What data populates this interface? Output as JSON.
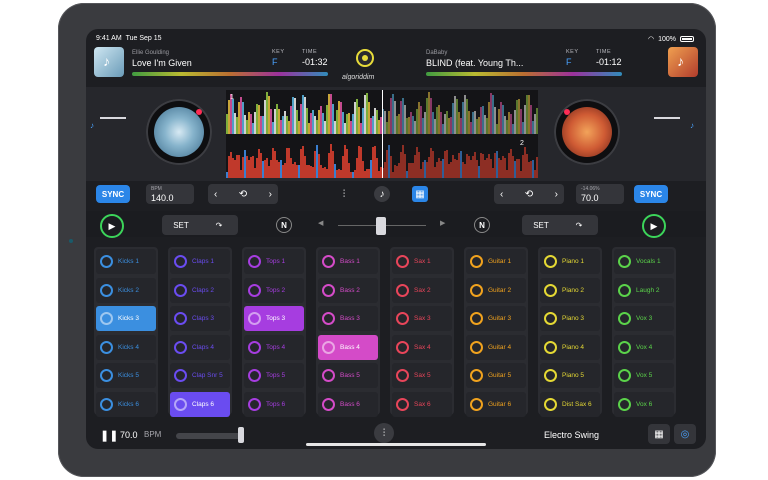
{
  "status": {
    "time": "9:41 AM",
    "date": "Tue Sep 15",
    "battery": "100%"
  },
  "deck_left": {
    "artist": "Ellie Goulding",
    "title": "Love I'm Given",
    "key_label": "KEY",
    "key": "F",
    "time_label": "TIME",
    "time": "-01:32",
    "bpm_label": "BPM",
    "bpm": "140.0",
    "sync_label": "SYNC",
    "set_label": "SET",
    "wave_number": "1",
    "progress": 0.72
  },
  "deck_right": {
    "artist": "DaBaby",
    "title": "BLIND (feat. Young Th...",
    "key_label": "KEY",
    "key": "F",
    "time_label": "TIME",
    "time": "-01:12",
    "pitch_label": "-14.06%",
    "bpm": "70.0",
    "sync_label": "SYNC",
    "set_label": "SET",
    "wave_number": "2",
    "progress": 0.55
  },
  "brand": "algoriddim",
  "pad_columns": [
    {
      "color": "#3b8fe0",
      "active": 2,
      "pads": [
        "Kicks 1",
        "Kicks 2",
        "Kicks 3",
        "Kicks 4",
        "Kicks 5",
        "Kicks 6"
      ]
    },
    {
      "color": "#6a4cf0",
      "active": 5,
      "pads": [
        "Claps 1",
        "Claps 2",
        "Claps 3",
        "Claps 4",
        "Clap Snr 5",
        "Claps 6"
      ]
    },
    {
      "color": "#a63de0",
      "active": 2,
      "pads": [
        "Tops 1",
        "Tops 2",
        "Tops 3",
        "Tops 4",
        "Tops 5",
        "Tops 6"
      ]
    },
    {
      "color": "#d44bc8",
      "active": 3,
      "pads": [
        "Bass 1",
        "Bass 2",
        "Bass 3",
        "Bass 4",
        "Bass 5",
        "Bass 6"
      ]
    },
    {
      "color": "#e8455a",
      "active": -1,
      "pads": [
        "Sax 1",
        "Sax 2",
        "Sax 3",
        "Sax 4",
        "Sax 5",
        "Sax 6"
      ]
    },
    {
      "color": "#f0a21e",
      "active": -1,
      "pads": [
        "Guitar 1",
        "Guitar 2",
        "Guitar 3",
        "Guitar 4",
        "Guitar 5",
        "Guitar 6"
      ]
    },
    {
      "color": "#e4d834",
      "active": -1,
      "pads": [
        "Piano 1",
        "Piano 2",
        "Piano 3",
        "Piano 4",
        "Piano 5",
        "Dist Sax 6"
      ]
    },
    {
      "color": "#5bd24a",
      "active": -1,
      "pads": [
        "Vocals 1",
        "Laugh 2",
        "Vox 3",
        "Vox 4",
        "Vox 5",
        "Vox 6"
      ]
    }
  ],
  "bottom": {
    "bpm": "70.0",
    "bpm_label": "BPM",
    "genre": "Electro Swing"
  },
  "icons": {
    "play": "play-icon",
    "pause": "pause-icon",
    "loop": "loop-icon",
    "grid": "grid-icon",
    "mixer": "mixer-icon"
  }
}
